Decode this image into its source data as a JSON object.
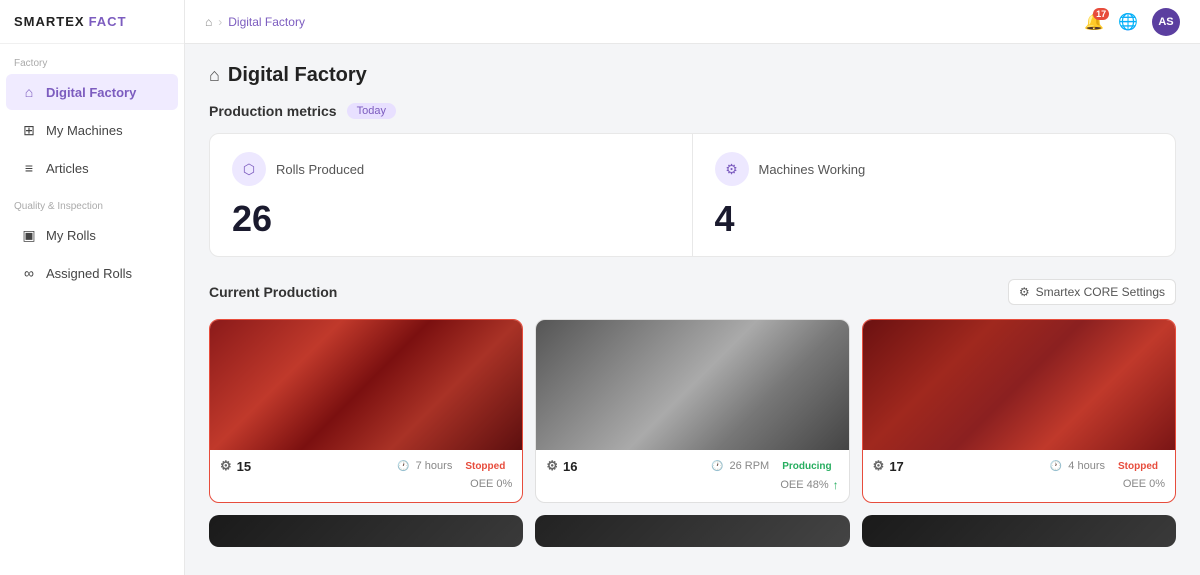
{
  "app": {
    "name": "SMARTEX",
    "name_accent": "FACT",
    "logo_icon": "◈"
  },
  "topbar": {
    "home_icon": "⌂",
    "breadcrumb_sep": "›",
    "breadcrumb_current": "Digital Factory",
    "notification_count": "17",
    "avatar_initials": "AS"
  },
  "sidebar": {
    "section_factory": "Factory",
    "section_quality": "Quality & Inspection",
    "nav_items": [
      {
        "id": "digital-factory",
        "label": "Digital Factory",
        "icon": "⌂",
        "active": true
      },
      {
        "id": "my-machines",
        "label": "My Machines",
        "icon": "⊞",
        "active": false
      },
      {
        "id": "articles",
        "label": "Articles",
        "icon": "≡",
        "active": false
      }
    ],
    "quality_items": [
      {
        "id": "my-rolls",
        "label": "My Rolls",
        "icon": "▣",
        "active": false
      },
      {
        "id": "assigned-rolls",
        "label": "Assigned Rolls",
        "icon": "∞",
        "active": false
      }
    ]
  },
  "page": {
    "icon": "⌂",
    "title": "Digital Factory",
    "metrics_section": "Production metrics",
    "today_label": "Today",
    "metrics": [
      {
        "id": "rolls-produced",
        "label": "Rolls Produced",
        "value": "26",
        "icon": "⬡"
      },
      {
        "id": "machines-working",
        "label": "Machines Working",
        "value": "4",
        "icon": "⚙"
      }
    ],
    "production_section": "Current Production",
    "settings_btn": "Smartex CORE Settings",
    "machines": [
      {
        "id": "15",
        "theme": "red",
        "hours": "7 hours",
        "rpm": null,
        "status": "Stopped",
        "status_type": "stopped",
        "oee": "OEE 0%",
        "oee_arrow": null
      },
      {
        "id": "16",
        "theme": "gray",
        "hours": null,
        "rpm": "26 RPM",
        "status": "Producing",
        "status_type": "producing",
        "oee": "OEE 48%",
        "oee_arrow": "↑"
      },
      {
        "id": "17",
        "theme": "darkred",
        "hours": "4 hours",
        "rpm": null,
        "status": "Stopped",
        "status_type": "stopped",
        "oee": "OEE 0%",
        "oee_arrow": null
      }
    ]
  },
  "colors": {
    "accent": "#7c5cbf",
    "stopped": "#e74c3c",
    "producing": "#27ae60"
  }
}
